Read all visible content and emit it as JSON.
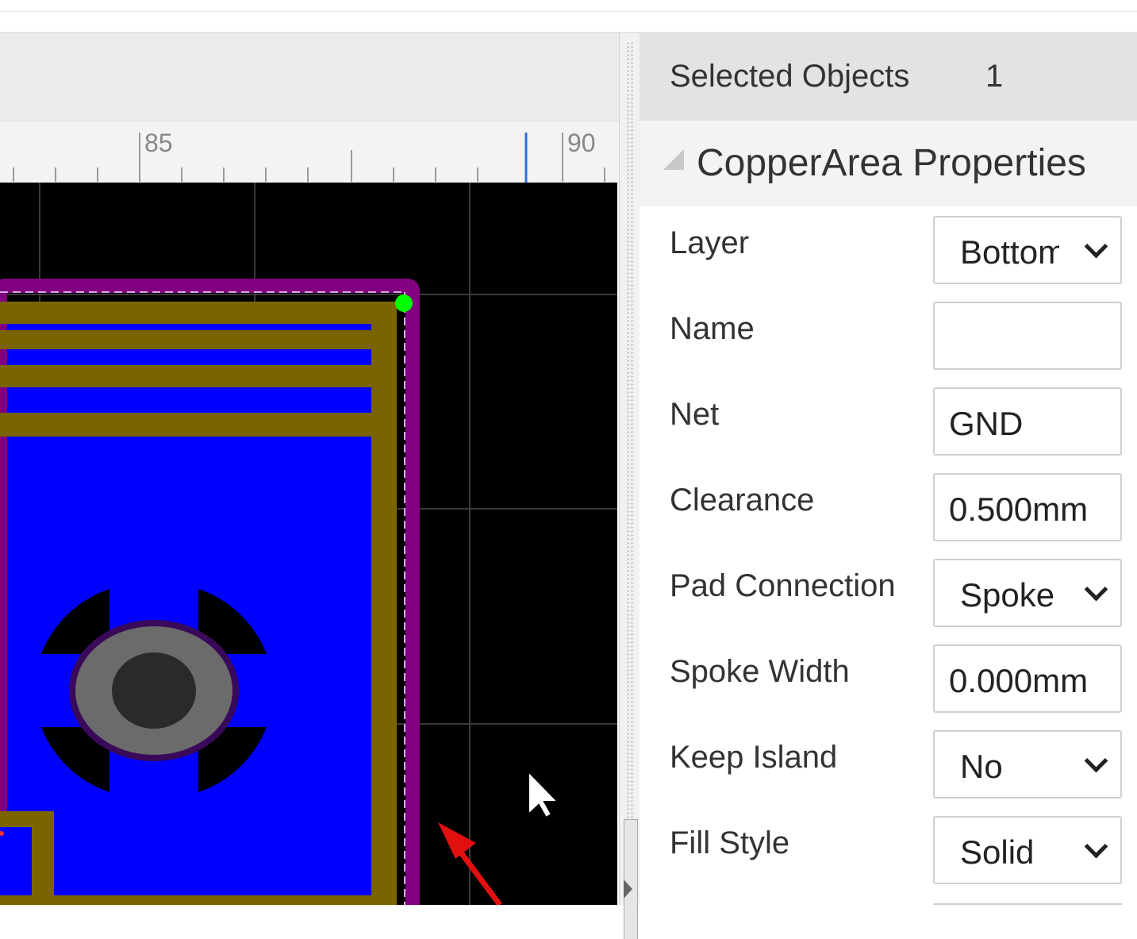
{
  "ruler": {
    "labels": [
      "85",
      "90"
    ]
  },
  "properties_panel": {
    "selected_objects_label": "Selected Objects",
    "selected_objects_count": "1",
    "section_title": "CopperArea Properties",
    "fields": [
      {
        "label": "Layer",
        "value": "Bottom",
        "type": "select"
      },
      {
        "label": "Name",
        "value": "",
        "type": "input"
      },
      {
        "label": "Net",
        "value": "GND",
        "type": "input"
      },
      {
        "label": "Clearance",
        "value": "0.500mm",
        "type": "input"
      },
      {
        "label": "Pad Connection",
        "value": "Spoke",
        "type": "select"
      },
      {
        "label": "Spoke Width",
        "value": "0.000mm",
        "type": "input"
      },
      {
        "label": "Keep Island",
        "value": "No",
        "type": "select"
      },
      {
        "label": "Fill Style",
        "value": "Solid",
        "type": "select"
      }
    ]
  },
  "colors": {
    "pcb_background": "#000000",
    "copper_fill": "#0000ff",
    "track": "#7a6400",
    "area_outline": "#800080",
    "pad": "#6b6b6b",
    "pad_hole": "#2a2a2a",
    "grid": "#3a3a3a",
    "vertex_handle": "#00ff00",
    "annotation_arrow": "#e01010"
  }
}
